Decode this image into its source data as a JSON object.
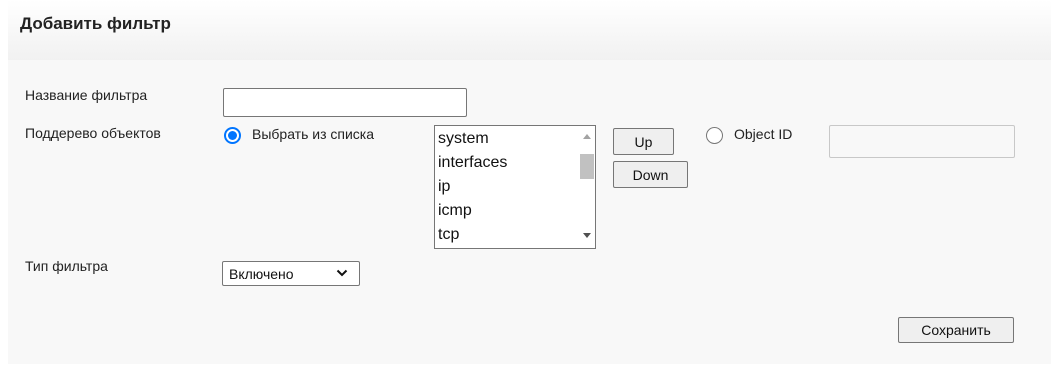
{
  "header": {
    "title": "Добавить фильтр"
  },
  "form": {
    "filter_name": {
      "label": "Название фильтра",
      "value": ""
    },
    "subtree": {
      "label": "Поддерево объектов",
      "option_list_label": "Выбрать из списка",
      "option_list_selected": true,
      "list_items": [
        "system",
        "interfaces",
        "ip",
        "icmp",
        "tcp"
      ],
      "up_button": "Up",
      "down_button": "Down",
      "option_oid_label": "Object ID",
      "option_oid_selected": false,
      "oid_value": ""
    },
    "filter_type": {
      "label": "Тип фильтра",
      "selected": "Включено"
    },
    "save_button": "Сохранить"
  },
  "colors": {
    "accent": "#0075ff",
    "panel_bg": "#f8f8f8",
    "button_bg": "#efefef"
  }
}
